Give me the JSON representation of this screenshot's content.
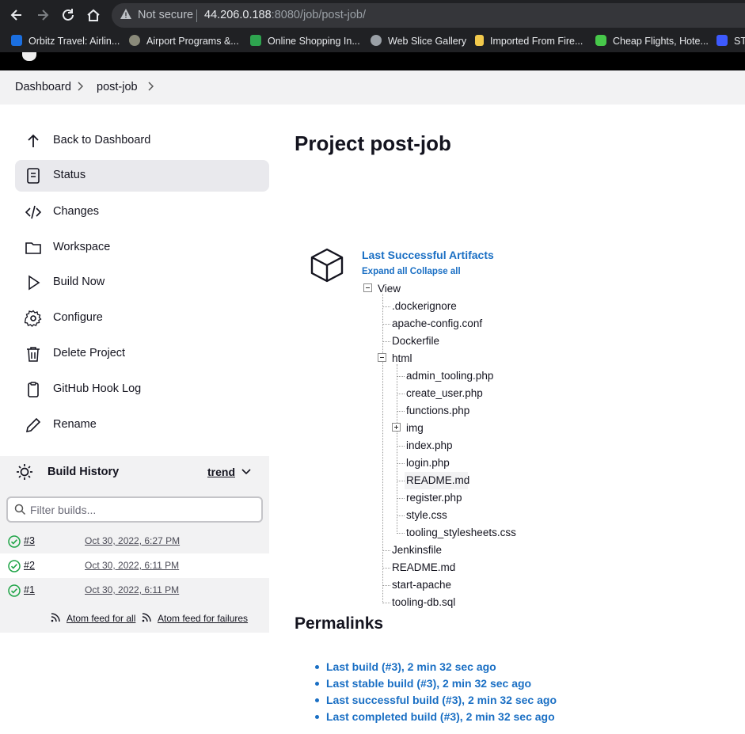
{
  "browser": {
    "security_label": "Not secure",
    "url_host": "44.206.0.188",
    "url_rest": ":8080/job/post-job/",
    "bookmarks": [
      {
        "label": "Orbitz Travel: Airlin...",
        "icon": "orbitz-icon",
        "color": "#1b6fe0"
      },
      {
        "label": "Airport Programs &...",
        "icon": "faa-seal-icon",
        "color": "#8a8a7a"
      },
      {
        "label": "Online Shopping In...",
        "icon": "shopping-icon",
        "color": "#2ea44f"
      },
      {
        "label": "Web Slice Gallery",
        "icon": "globe-icon",
        "color": "#9aa0a6"
      },
      {
        "label": "Imported From Fire...",
        "icon": "folder-icon",
        "color": "#f2c94c"
      },
      {
        "label": "Cheap Flights, Hote...",
        "icon": "plane-icon",
        "color": "#47c84a"
      },
      {
        "label": "ST",
        "icon": "shield-icon",
        "color": "#3d5afe"
      }
    ]
  },
  "breadcrumb": {
    "items": [
      "Dashboard",
      "post-job"
    ]
  },
  "sidebar": {
    "items": [
      {
        "label": "Back to Dashboard",
        "icon": "arrow-up-icon"
      },
      {
        "label": "Status",
        "icon": "document-icon",
        "active": true
      },
      {
        "label": "Changes",
        "icon": "code-icon"
      },
      {
        "label": "Workspace",
        "icon": "folder-icon"
      },
      {
        "label": "Build Now",
        "icon": "play-icon"
      },
      {
        "label": "Configure",
        "icon": "gear-icon"
      },
      {
        "label": "Delete Project",
        "icon": "trash-icon"
      },
      {
        "label": "GitHub Hook Log",
        "icon": "clipboard-icon"
      },
      {
        "label": "Rename",
        "icon": "pencil-icon"
      }
    ]
  },
  "build_history": {
    "title": "Build History",
    "trend_label": "trend",
    "filter_placeholder": "Filter builds...",
    "builds": [
      {
        "number": "#3",
        "date": "Oct 30, 2022, 6:27 PM"
      },
      {
        "number": "#2",
        "date": "Oct 30, 2022, 6:11 PM"
      },
      {
        "number": "#1",
        "date": "Oct 30, 2022, 6:11 PM"
      }
    ],
    "feed_all": "Atom feed for all",
    "feed_failures": "Atom feed for failures"
  },
  "main": {
    "title": "Project post-job",
    "artifacts_title": "Last Successful Artifacts",
    "expand_all": "Expand all",
    "collapse_all": "Collapse all",
    "tree": {
      "root": "View",
      "items": [
        ".dockerignore",
        "apache-config.conf",
        "Dockerfile",
        "html",
        "Jenkinsfile",
        "README.md",
        "start-apache",
        "tooling-db.sql"
      ],
      "html_items": [
        "admin_tooling.php",
        "create_user.php",
        "functions.php",
        "img",
        "index.php",
        "login.php",
        "README.md",
        "register.php",
        "style.css",
        "tooling_stylesheets.css"
      ]
    },
    "permalinks_title": "Permalinks",
    "permalinks": [
      "Last build (#3), 2 min 32 sec ago",
      "Last stable build (#3), 2 min 32 sec ago",
      "Last successful build (#3), 2 min 32 sec ago",
      "Last completed build (#3), 2 min 32 sec ago"
    ]
  },
  "colors": {
    "link": "#1a6fc4",
    "success": "#1ea446",
    "chrome_bg": "#202124"
  }
}
